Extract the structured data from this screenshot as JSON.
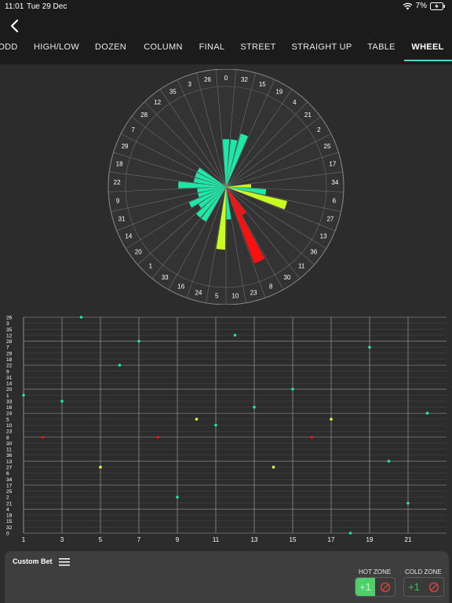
{
  "status": {
    "time": "11:01",
    "date": "Tue 29 Dec",
    "battery": "7%"
  },
  "tabs": [
    {
      "label": "ODD"
    },
    {
      "label": "HIGH/LOW"
    },
    {
      "label": "DOZEN"
    },
    {
      "label": "COLUMN"
    },
    {
      "label": "FINAL"
    },
    {
      "label": "STREET"
    },
    {
      "label": "STRAIGHT UP"
    },
    {
      "label": "TABLE"
    },
    {
      "label": "WHEEL",
      "active": true
    }
  ],
  "colors": {
    "hot_green": "#1de8a5",
    "lime": "#c8ff1e",
    "red": "#ff1010",
    "accent": "#4fd6c6",
    "yellow": "#f0f040"
  },
  "wheel": {
    "numbers": [
      0,
      32,
      15,
      19,
      4,
      21,
      2,
      25,
      17,
      34,
      6,
      27,
      13,
      36,
      11,
      30,
      8,
      23,
      10,
      5,
      24,
      16,
      33,
      1,
      20,
      14,
      31,
      9,
      22,
      18,
      29,
      7,
      28,
      12,
      35,
      3,
      26
    ],
    "bars": [
      {
        "number": 0,
        "level": 0.55,
        "color": "green"
      },
      {
        "number": 32,
        "level": 0.55,
        "color": "green"
      },
      {
        "number": 15,
        "level": 0.65,
        "color": "green"
      },
      {
        "number": 31,
        "level": 0.3,
        "color": "green"
      },
      {
        "number": 9,
        "level": 0.3,
        "color": "green"
      },
      {
        "number": 22,
        "level": 0.55,
        "color": "green"
      },
      {
        "number": 18,
        "level": 0.35,
        "color": "green"
      },
      {
        "number": 29,
        "level": 0.35,
        "color": "green"
      },
      {
        "number": 7,
        "level": 0.35,
        "color": "green"
      },
      {
        "number": 33,
        "level": 0.45,
        "color": "green"
      },
      {
        "number": 1,
        "level": 0.45,
        "color": "green"
      },
      {
        "number": 20,
        "level": 0.35,
        "color": "green"
      },
      {
        "number": 14,
        "level": 0.45,
        "color": "green"
      },
      {
        "number": 6,
        "level": 0.45,
        "color": "green"
      },
      {
        "number": 34,
        "level": 0.25,
        "color": "lime"
      },
      {
        "number": 27,
        "level": 0.75,
        "color": "lime"
      },
      {
        "number": 5,
        "level": 0.75,
        "color": "lime"
      },
      {
        "number": 10,
        "level": 0.35,
        "color": "green"
      },
      {
        "number": 8,
        "level": 1.0,
        "color": "red"
      },
      {
        "number": 30,
        "level": 0.35,
        "color": "red"
      }
    ]
  },
  "chart_data": {
    "type": "scatter",
    "title": "",
    "xlabel": "",
    "ylabel": "",
    "x_ticks": [
      1,
      3,
      5,
      7,
      9,
      11,
      13,
      15,
      17,
      19,
      21
    ],
    "xlim": [
      1,
      23
    ],
    "y_categories": [
      0,
      32,
      15,
      19,
      4,
      21,
      2,
      25,
      17,
      34,
      6,
      27,
      13,
      36,
      11,
      30,
      8,
      23,
      10,
      5,
      24,
      16,
      33,
      1,
      20,
      14,
      31,
      9,
      22,
      18,
      29,
      7,
      28,
      12,
      35,
      3,
      26
    ],
    "points": [
      {
        "x": 1,
        "y": 1,
        "color": "green"
      },
      {
        "x": 2,
        "y": 8,
        "color": "red"
      },
      {
        "x": 3,
        "y": 33,
        "color": "green"
      },
      {
        "x": 4,
        "y": 26,
        "color": "green"
      },
      {
        "x": 5,
        "y": 27,
        "color": "yellow"
      },
      {
        "x": 6,
        "y": 22,
        "color": "green"
      },
      {
        "x": 7,
        "y": 28,
        "color": "green"
      },
      {
        "x": 8,
        "y": 8,
        "color": "red"
      },
      {
        "x": 9,
        "y": 2,
        "color": "green"
      },
      {
        "x": 10,
        "y": 5,
        "color": "yellow"
      },
      {
        "x": 11,
        "y": 10,
        "color": "green"
      },
      {
        "x": 12,
        "y": 12,
        "color": "green"
      },
      {
        "x": 13,
        "y": 16,
        "color": "green"
      },
      {
        "x": 14,
        "y": 27,
        "color": "yellow"
      },
      {
        "x": 15,
        "y": 20,
        "color": "green"
      },
      {
        "x": 16,
        "y": 8,
        "color": "red"
      },
      {
        "x": 17,
        "y": 5,
        "color": "yellow"
      },
      {
        "x": 18,
        "y": 0,
        "color": "green"
      },
      {
        "x": 19,
        "y": 7,
        "color": "green"
      },
      {
        "x": 20,
        "y": 13,
        "color": "green"
      },
      {
        "x": 21,
        "y": 21,
        "color": "green"
      },
      {
        "x": 22,
        "y": 24,
        "color": "green"
      }
    ]
  },
  "custom_bet": {
    "title": "Custom Bet",
    "hot_zone_label": "HOT ZONE",
    "cold_zone_label": "COLD ZONE",
    "plus_label": "+1"
  }
}
